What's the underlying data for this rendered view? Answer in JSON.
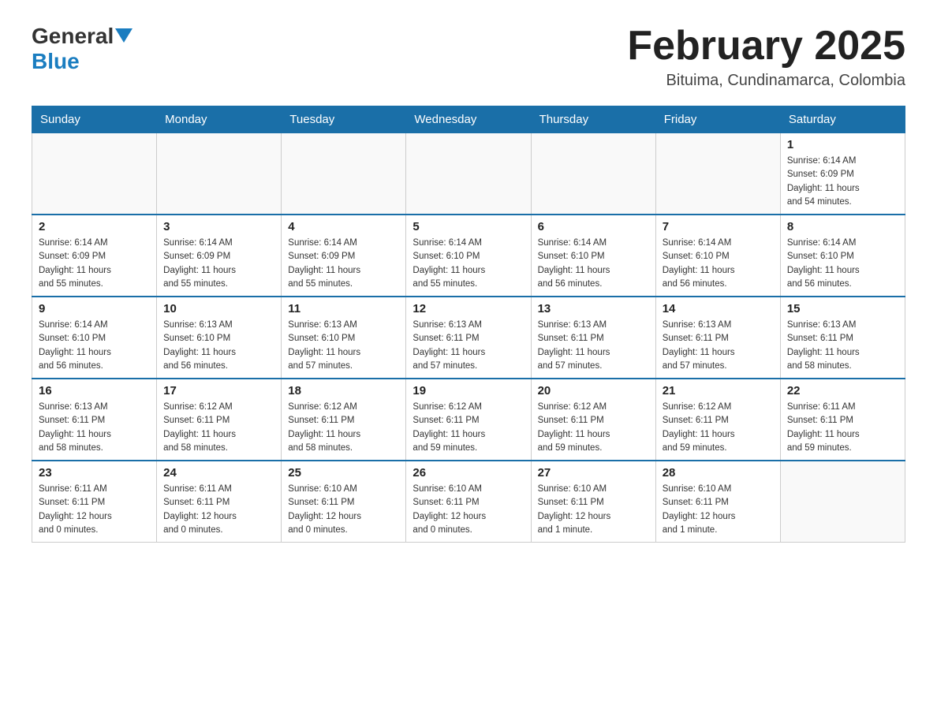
{
  "header": {
    "logo": {
      "general": "General",
      "blue": "Blue",
      "tagline": ""
    },
    "title": "February 2025",
    "subtitle": "Bituima, Cundinamarca, Colombia"
  },
  "weekdays": [
    "Sunday",
    "Monday",
    "Tuesday",
    "Wednesday",
    "Thursday",
    "Friday",
    "Saturday"
  ],
  "weeks": [
    [
      {
        "day": "",
        "info": ""
      },
      {
        "day": "",
        "info": ""
      },
      {
        "day": "",
        "info": ""
      },
      {
        "day": "",
        "info": ""
      },
      {
        "day": "",
        "info": ""
      },
      {
        "day": "",
        "info": ""
      },
      {
        "day": "1",
        "info": "Sunrise: 6:14 AM\nSunset: 6:09 PM\nDaylight: 11 hours\nand 54 minutes."
      }
    ],
    [
      {
        "day": "2",
        "info": "Sunrise: 6:14 AM\nSunset: 6:09 PM\nDaylight: 11 hours\nand 55 minutes."
      },
      {
        "day": "3",
        "info": "Sunrise: 6:14 AM\nSunset: 6:09 PM\nDaylight: 11 hours\nand 55 minutes."
      },
      {
        "day": "4",
        "info": "Sunrise: 6:14 AM\nSunset: 6:09 PM\nDaylight: 11 hours\nand 55 minutes."
      },
      {
        "day": "5",
        "info": "Sunrise: 6:14 AM\nSunset: 6:10 PM\nDaylight: 11 hours\nand 55 minutes."
      },
      {
        "day": "6",
        "info": "Sunrise: 6:14 AM\nSunset: 6:10 PM\nDaylight: 11 hours\nand 56 minutes."
      },
      {
        "day": "7",
        "info": "Sunrise: 6:14 AM\nSunset: 6:10 PM\nDaylight: 11 hours\nand 56 minutes."
      },
      {
        "day": "8",
        "info": "Sunrise: 6:14 AM\nSunset: 6:10 PM\nDaylight: 11 hours\nand 56 minutes."
      }
    ],
    [
      {
        "day": "9",
        "info": "Sunrise: 6:14 AM\nSunset: 6:10 PM\nDaylight: 11 hours\nand 56 minutes."
      },
      {
        "day": "10",
        "info": "Sunrise: 6:13 AM\nSunset: 6:10 PM\nDaylight: 11 hours\nand 56 minutes."
      },
      {
        "day": "11",
        "info": "Sunrise: 6:13 AM\nSunset: 6:10 PM\nDaylight: 11 hours\nand 57 minutes."
      },
      {
        "day": "12",
        "info": "Sunrise: 6:13 AM\nSunset: 6:11 PM\nDaylight: 11 hours\nand 57 minutes."
      },
      {
        "day": "13",
        "info": "Sunrise: 6:13 AM\nSunset: 6:11 PM\nDaylight: 11 hours\nand 57 minutes."
      },
      {
        "day": "14",
        "info": "Sunrise: 6:13 AM\nSunset: 6:11 PM\nDaylight: 11 hours\nand 57 minutes."
      },
      {
        "day": "15",
        "info": "Sunrise: 6:13 AM\nSunset: 6:11 PM\nDaylight: 11 hours\nand 58 minutes."
      }
    ],
    [
      {
        "day": "16",
        "info": "Sunrise: 6:13 AM\nSunset: 6:11 PM\nDaylight: 11 hours\nand 58 minutes."
      },
      {
        "day": "17",
        "info": "Sunrise: 6:12 AM\nSunset: 6:11 PM\nDaylight: 11 hours\nand 58 minutes."
      },
      {
        "day": "18",
        "info": "Sunrise: 6:12 AM\nSunset: 6:11 PM\nDaylight: 11 hours\nand 58 minutes."
      },
      {
        "day": "19",
        "info": "Sunrise: 6:12 AM\nSunset: 6:11 PM\nDaylight: 11 hours\nand 59 minutes."
      },
      {
        "day": "20",
        "info": "Sunrise: 6:12 AM\nSunset: 6:11 PM\nDaylight: 11 hours\nand 59 minutes."
      },
      {
        "day": "21",
        "info": "Sunrise: 6:12 AM\nSunset: 6:11 PM\nDaylight: 11 hours\nand 59 minutes."
      },
      {
        "day": "22",
        "info": "Sunrise: 6:11 AM\nSunset: 6:11 PM\nDaylight: 11 hours\nand 59 minutes."
      }
    ],
    [
      {
        "day": "23",
        "info": "Sunrise: 6:11 AM\nSunset: 6:11 PM\nDaylight: 12 hours\nand 0 minutes."
      },
      {
        "day": "24",
        "info": "Sunrise: 6:11 AM\nSunset: 6:11 PM\nDaylight: 12 hours\nand 0 minutes."
      },
      {
        "day": "25",
        "info": "Sunrise: 6:10 AM\nSunset: 6:11 PM\nDaylight: 12 hours\nand 0 minutes."
      },
      {
        "day": "26",
        "info": "Sunrise: 6:10 AM\nSunset: 6:11 PM\nDaylight: 12 hours\nand 0 minutes."
      },
      {
        "day": "27",
        "info": "Sunrise: 6:10 AM\nSunset: 6:11 PM\nDaylight: 12 hours\nand 1 minute."
      },
      {
        "day": "28",
        "info": "Sunrise: 6:10 AM\nSunset: 6:11 PM\nDaylight: 12 hours\nand 1 minute."
      },
      {
        "day": "",
        "info": ""
      }
    ]
  ]
}
